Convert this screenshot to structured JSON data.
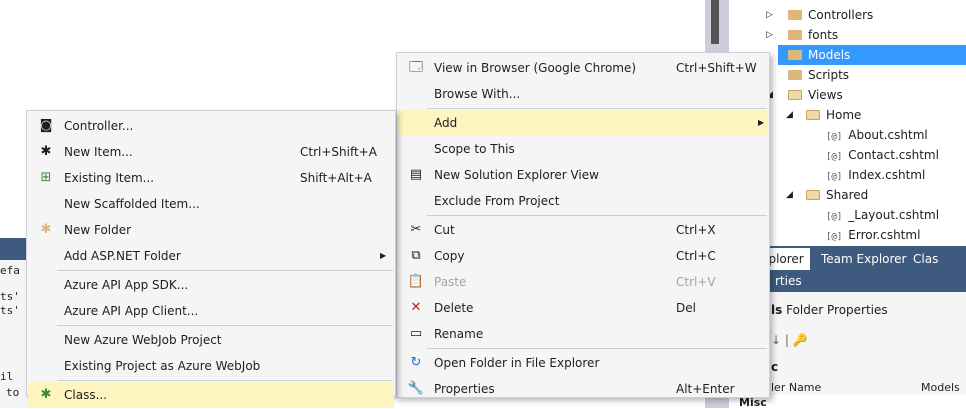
{
  "background": {
    "code_fragments": [
      "efa",
      "ts'",
      "ts'",
      "il",
      "to SosusudSchool"
    ]
  },
  "solution_explorer": {
    "items": [
      {
        "label": "Controllers",
        "type": "folder",
        "expander": "▷"
      },
      {
        "label": "fonts",
        "type": "folder",
        "expander": "▷"
      },
      {
        "label": "Models",
        "type": "folder",
        "expander": "",
        "selected": true
      },
      {
        "label": "Scripts",
        "type": "folder",
        "expander": ""
      },
      {
        "label": "Views",
        "type": "folder-open",
        "expander": "◢"
      },
      {
        "label": "Home",
        "type": "folder-open",
        "expander": "◢"
      },
      {
        "label": "About.cshtml",
        "type": "razor",
        "icon_text": "[@]"
      },
      {
        "label": "Contact.cshtml",
        "type": "razor",
        "icon_text": "[@]"
      },
      {
        "label": "Index.cshtml",
        "type": "razor",
        "icon_text": "[@]"
      },
      {
        "label": "Shared",
        "type": "folder-open",
        "expander": "◢"
      },
      {
        "label": "_Layout.cshtml",
        "type": "razor",
        "icon_text": "[@]"
      },
      {
        "label": "Error.cshtml",
        "type": "razor",
        "icon_text": "[@]"
      }
    ]
  },
  "panel_tabs": [
    "on Explorer",
    "Team Explorer",
    "Clas"
  ],
  "properties": {
    "header": "rties",
    "object_name": "ls",
    "object_type": "Folder Properties",
    "toolbar": "↓ | 🔑",
    "category": "c",
    "row_name": "ler Name",
    "row_value": "Models",
    "misc_label": "Misc"
  },
  "main_menu": {
    "items": [
      {
        "label": "View in Browser (Google Chrome)",
        "shortcut": "Ctrl+Shift+W",
        "icon": "browser-icon",
        "glyph": "🗔"
      },
      {
        "label": "Browse With...",
        "shortcut": "",
        "icon": "",
        "glyph": ""
      },
      {
        "label": "Add",
        "shortcut": "",
        "icon": "",
        "glyph": "",
        "submenu_arrow": "▶",
        "highlight": true
      },
      {
        "label": "Scope to This",
        "shortcut": "",
        "icon": "",
        "glyph": ""
      },
      {
        "label": "New Solution Explorer View",
        "shortcut": "",
        "icon": "solution-view-icon",
        "glyph": "▤"
      },
      {
        "label": "Exclude From Project",
        "shortcut": "",
        "icon": "",
        "glyph": ""
      },
      {
        "label": "Cut",
        "shortcut": "Ctrl+X",
        "icon": "cut-icon",
        "glyph": "✂"
      },
      {
        "label": "Copy",
        "shortcut": "Ctrl+C",
        "icon": "copy-icon",
        "glyph": "⧉"
      },
      {
        "label": "Paste",
        "shortcut": "Ctrl+V",
        "icon": "paste-icon",
        "glyph": "📋",
        "disabled": true
      },
      {
        "label": "Delete",
        "shortcut": "Del",
        "icon": "delete-icon",
        "glyph": "✕",
        "color": "#c51916"
      },
      {
        "label": "Rename",
        "shortcut": "",
        "icon": "rename-icon",
        "glyph": "▭"
      },
      {
        "label": "Open Folder in File Explorer",
        "shortcut": "",
        "icon": "refresh-icon",
        "glyph": "↻",
        "color": "#1e6fc7"
      },
      {
        "label": "Properties",
        "shortcut": "Alt+Enter",
        "icon": "wrench-icon",
        "glyph": "🔧"
      }
    ]
  },
  "add_submenu": {
    "items": [
      {
        "label": "Controller...",
        "shortcut": "",
        "icon": "controller-icon",
        "glyph": "◙"
      },
      {
        "label": "New Item...",
        "shortcut": "Ctrl+Shift+A",
        "icon": "new-item-icon",
        "glyph": "✱"
      },
      {
        "label": "Existing Item...",
        "shortcut": "Shift+Alt+A",
        "icon": "existing-item-icon",
        "glyph": "⊞",
        "color": "#388a34"
      },
      {
        "label": "New Scaffolded Item...",
        "shortcut": "",
        "icon": "",
        "glyph": ""
      },
      {
        "label": "New Folder",
        "shortcut": "",
        "icon": "new-folder-icon",
        "glyph": "✱",
        "color": "#dcb67a"
      },
      {
        "label": "Add ASP.NET Folder",
        "shortcut": "",
        "icon": "",
        "glyph": "",
        "submenu_arrow": "▶"
      },
      {
        "label": "Azure API App SDK...",
        "shortcut": "",
        "icon": "",
        "glyph": ""
      },
      {
        "label": "Azure API App Client...",
        "shortcut": "",
        "icon": "",
        "glyph": ""
      },
      {
        "label": "New Azure WebJob Project",
        "shortcut": "",
        "icon": "",
        "glyph": ""
      },
      {
        "label": "Existing Project as Azure WebJob",
        "shortcut": "",
        "icon": "",
        "glyph": ""
      },
      {
        "label": "Class...",
        "shortcut": "",
        "icon": "class-icon",
        "glyph": "✱",
        "color": "#388a34",
        "highlight": true
      }
    ]
  }
}
